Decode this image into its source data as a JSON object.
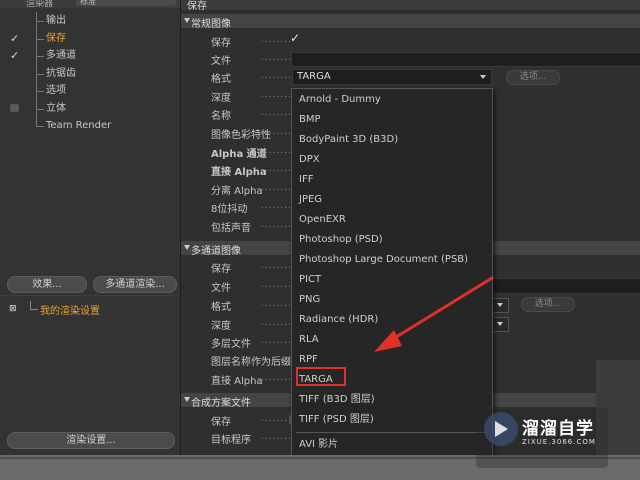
{
  "left": {
    "renderer_label": "渲染器",
    "renderer_value": "标准",
    "tree": [
      {
        "label": "输出",
        "checked": false,
        "box": false,
        "active": false
      },
      {
        "label": "保存",
        "checked": true,
        "box": false,
        "active": true
      },
      {
        "label": "多通道",
        "checked": true,
        "box": false,
        "active": false
      },
      {
        "label": "抗锯齿",
        "checked": false,
        "box": false,
        "active": false
      },
      {
        "label": "选项",
        "checked": false,
        "box": false,
        "active": false
      },
      {
        "label": "立体",
        "checked": false,
        "box": true,
        "active": false
      },
      {
        "label": "Team Render",
        "checked": false,
        "box": false,
        "active": false
      }
    ],
    "btn_effects": "效果...",
    "btn_multipass": "多通道渲染...",
    "preset_label": "我的渲染设置",
    "btn_render_settings": "渲染设置..."
  },
  "right": {
    "header": "保存",
    "sec_regular": "常规图像",
    "regular_props": [
      "保存",
      "文件",
      "格式",
      "深度",
      "名称",
      "图像色彩特性",
      "Alpha 通道",
      "直接 Alpha",
      "分离 Alpha",
      "8位抖动",
      "包括声音"
    ],
    "format_value": "TARGA",
    "options_btn": "选项...",
    "sec_multipass": "多通道图像",
    "multipass_props": [
      "保存",
      "文件",
      "格式",
      "深度",
      "多层文件",
      "图层名称作为后缀",
      "直接 Alpha"
    ],
    "sec_compositing": "合成方案文件",
    "compositing_props": [
      "保存",
      "目标程序"
    ]
  },
  "dropdown": {
    "items": [
      "Arnold - Dummy",
      "BMP",
      "BodyPaint 3D (B3D)",
      "DPX",
      "IFF",
      "JPEG",
      "OpenEXR",
      "Photoshop (PSD)",
      "Photoshop Large Document (PSB)",
      "PICT",
      "PNG",
      "Radiance (HDR)",
      "RLA",
      "RPF",
      "TARGA",
      "TIFF (B3D 图层)",
      "TIFF (PSD 图层)"
    ],
    "extra_item": "AVI 影片",
    "highlighted": "TARGA"
  },
  "watermark": {
    "title": "溜溜自学",
    "subtitle": "ZIXUE.3066.COM"
  },
  "colors": {
    "accent_orange": "#e8a33a",
    "highlight_red": "#e0302a"
  }
}
